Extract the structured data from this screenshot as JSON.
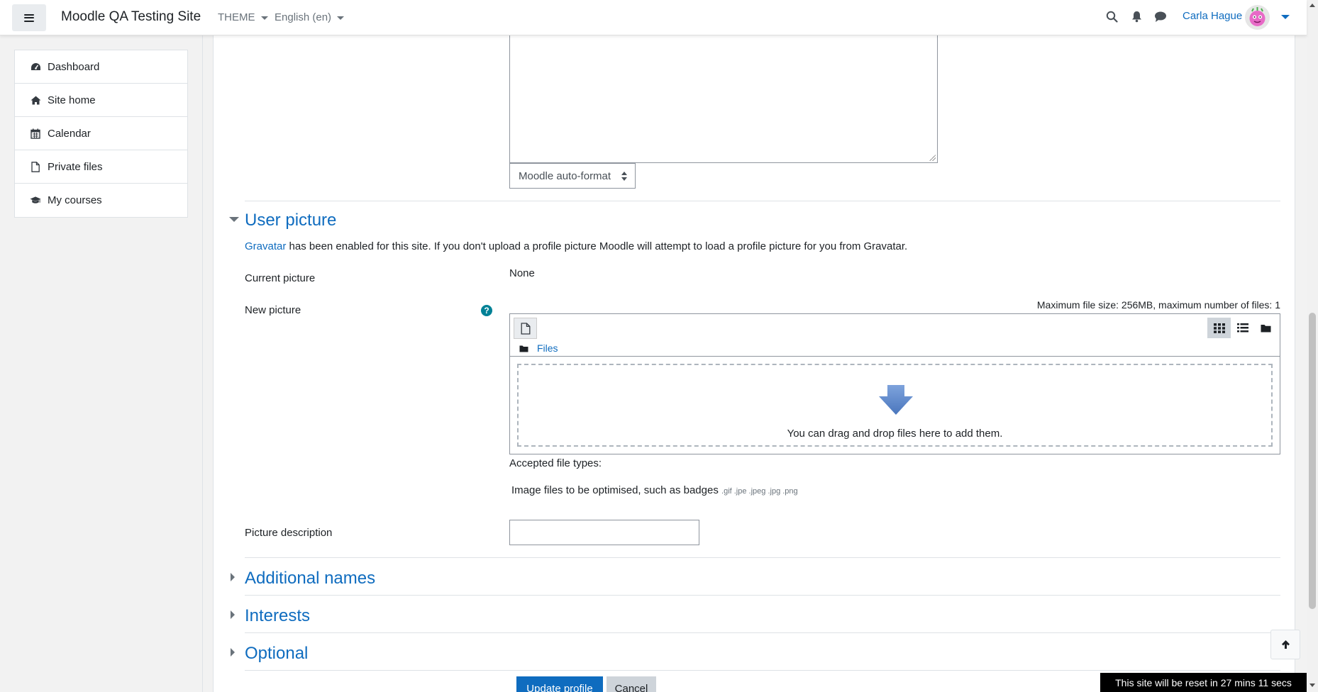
{
  "navbar": {
    "site_name": "Moodle QA Testing Site",
    "theme_menu": "THEME",
    "language_menu": "English (en)",
    "user_name": "Carla Hague"
  },
  "drawer": {
    "items": [
      {
        "label": "Dashboard",
        "icon": "dashboard-icon"
      },
      {
        "label": "Site home",
        "icon": "home-icon"
      },
      {
        "label": "Calendar",
        "icon": "calendar-icon"
      },
      {
        "label": "Private files",
        "icon": "file-icon"
      },
      {
        "label": "My courses",
        "icon": "graduation-cap-icon"
      }
    ]
  },
  "description_editor": {
    "format_select": "Moodle auto-format"
  },
  "user_picture": {
    "heading": "User picture",
    "gravatar_link": "Gravatar",
    "gravatar_text": "has been enabled for this site. If you don't upload a profile picture Moodle will attempt to load a profile picture for you from Gravatar.",
    "current_picture_label": "Current picture",
    "current_picture_value": "None",
    "new_picture_label": "New picture",
    "max_file_info": "Maximum file size: 256MB, maximum number of files: 1",
    "files_path": "Files",
    "drop_text": "You can drag and drop files here to add them.",
    "accepted_label": "Accepted file types:",
    "accepted_desc": "Image files to be optimised, such as badges",
    "accepted_exts": ".gif .jpe .jpeg .jpg .png",
    "picture_description_label": "Picture description",
    "picture_description_value": ""
  },
  "sections": {
    "additional_names": "Additional names",
    "interests": "Interests",
    "optional": "Optional"
  },
  "buttons": {
    "update_profile": "Update profile",
    "cancel": "Cancel"
  },
  "reset_banner": "This site will be reset in 27 mins 11 secs",
  "colors": {
    "link": "#0f6cbf",
    "primary_button": "#0f6cbf",
    "help_icon": "#008196",
    "drop_arrow": "#5b87c8"
  }
}
